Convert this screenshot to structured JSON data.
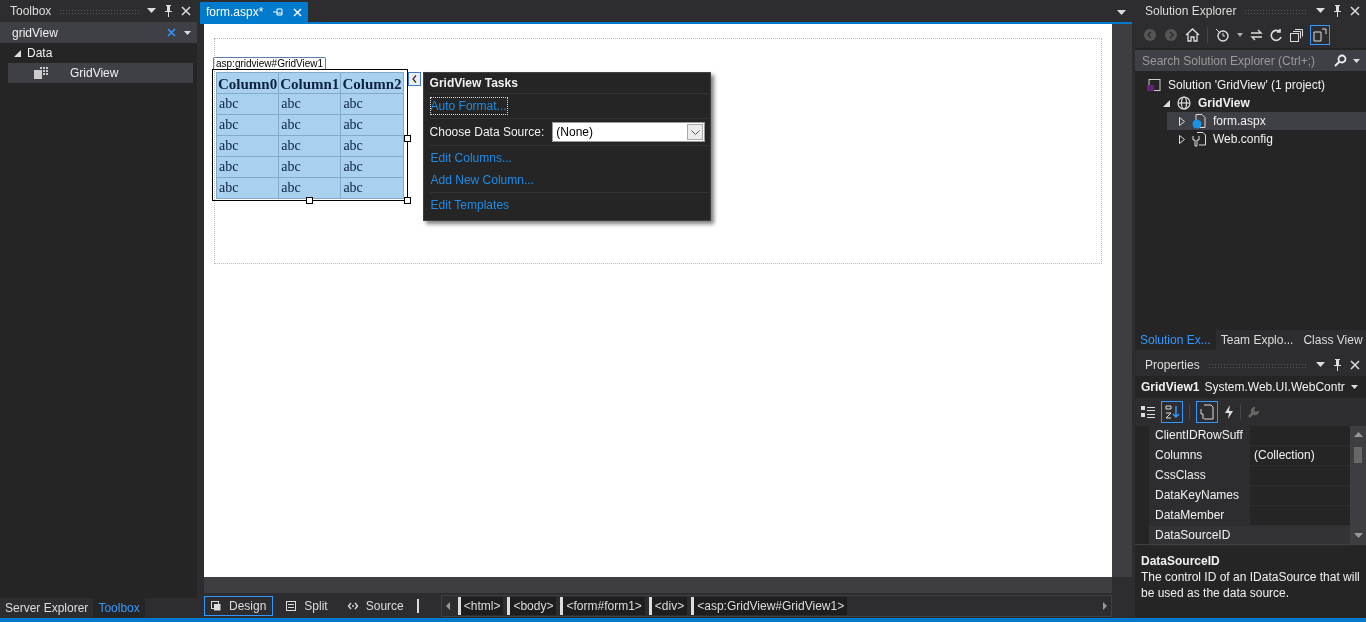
{
  "toolbox": {
    "title": "Toolbox",
    "search": {
      "value": "gridView"
    },
    "groups": [
      {
        "label": "Data",
        "expanded": true,
        "items": [
          {
            "label": "GridView",
            "selected": true
          }
        ]
      }
    ],
    "bottom_tabs": [
      {
        "label": "Server Explorer",
        "selected": false
      },
      {
        "label": "Toolbox",
        "selected": true
      }
    ]
  },
  "document": {
    "tabs": [
      {
        "label": "form.aspx*",
        "selected": true
      }
    ],
    "control_tag": "asp:gridview#GridView1",
    "grid": {
      "columns": [
        "Column0",
        "Column1",
        "Column2"
      ],
      "rows": [
        [
          "abc",
          "abc",
          "abc"
        ],
        [
          "abc",
          "abc",
          "abc"
        ],
        [
          "abc",
          "abc",
          "abc"
        ],
        [
          "abc",
          "abc",
          "abc"
        ],
        [
          "abc",
          "abc",
          "abc"
        ]
      ]
    },
    "smart_tag": {
      "title": "GridView Tasks",
      "sections": [
        [
          {
            "kind": "link",
            "label": "Auto Format...",
            "focused": true
          }
        ],
        [
          {
            "kind": "dropdown",
            "label": "Choose Data Source:",
            "value": "(None)"
          }
        ],
        [
          {
            "kind": "link",
            "label": "Edit Columns...",
            "focused": false
          },
          {
            "kind": "link",
            "label": "Add New Column...",
            "focused": false
          }
        ],
        [
          {
            "kind": "link",
            "label": "Edit Templates",
            "focused": false
          }
        ]
      ]
    },
    "view_tabs": [
      {
        "kind": "design",
        "label": "Design",
        "selected": true
      },
      {
        "kind": "split",
        "label": "Split",
        "selected": false
      },
      {
        "kind": "source",
        "label": "Source",
        "selected": false
      }
    ],
    "breadcrumbs": [
      "<html>",
      "<body>",
      "<form#form1>",
      "<div>",
      "<asp:GridView#GridView1>"
    ]
  },
  "solution_explorer": {
    "title": "Solution Explorer",
    "search": {
      "placeholder": "Search Solution Explorer (Ctrl+;)"
    },
    "tree": [
      {
        "kind": "solution",
        "label": "Solution 'GridView' (1 project)",
        "children": [
          {
            "kind": "project",
            "label": "GridView",
            "expanded": true,
            "selected": false,
            "children": [
              {
                "kind": "page",
                "label": "form.aspx",
                "expanded": false,
                "selected": true
              },
              {
                "kind": "config",
                "label": "Web.config",
                "expanded": false,
                "selected": false
              }
            ]
          }
        ]
      }
    ],
    "bottom_tabs": [
      {
        "label": "Solution Ex...",
        "selected": true
      },
      {
        "label": "Team Explo...",
        "selected": false
      },
      {
        "label": "Class View",
        "selected": false
      }
    ]
  },
  "properties": {
    "title": "Properties",
    "object_name": "GridView1",
    "object_type": "System.Web.UI.WebContr",
    "rows": [
      {
        "name": "ClientIDRowSuff",
        "value": "",
        "selected": false
      },
      {
        "name": "Columns",
        "value": "(Collection)",
        "selected": false
      },
      {
        "name": "CssClass",
        "value": "",
        "selected": false
      },
      {
        "name": "DataKeyNames",
        "value": "",
        "selected": false
      },
      {
        "name": "DataMember",
        "value": "",
        "selected": false
      },
      {
        "name": "DataSourceID",
        "value": "",
        "selected": true
      }
    ],
    "description": {
      "title": "DataSourceID",
      "text": "The control ID of an IDataSource that will be used as the data source."
    }
  }
}
